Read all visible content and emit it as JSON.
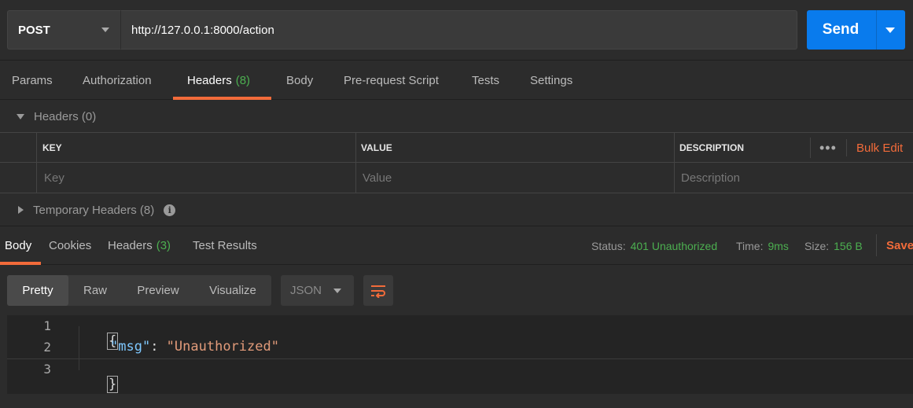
{
  "request": {
    "method": "POST",
    "url": "http://127.0.0.1:8000/action",
    "send_label": "Send"
  },
  "request_tabs": [
    {
      "label": "Params"
    },
    {
      "label": "Authorization"
    },
    {
      "label": "Headers",
      "count": "(8)"
    },
    {
      "label": "Body"
    },
    {
      "label": "Pre-request Script"
    },
    {
      "label": "Tests"
    },
    {
      "label": "Settings"
    }
  ],
  "headers_section": {
    "title": "Headers (0)",
    "columns": {
      "key": "KEY",
      "value": "VALUE",
      "description": "DESCRIPTION"
    },
    "placeholders": {
      "key": "Key",
      "value": "Value",
      "description": "Description"
    },
    "more": "•••",
    "bulk_edit": "Bulk Edit",
    "temporary_title": "Temporary Headers (8)",
    "info": "i"
  },
  "response_tabs": [
    {
      "label": "Body"
    },
    {
      "label": "Cookies"
    },
    {
      "label": "Headers",
      "count": "(3)"
    },
    {
      "label": "Test Results"
    }
  ],
  "response_status": {
    "status_label": "Status:",
    "status_value": "401 Unauthorized",
    "time_label": "Time:",
    "time_value": "9ms",
    "size_label": "Size:",
    "size_value": "156 B",
    "save_label": "Save"
  },
  "view_modes": [
    {
      "label": "Pretty"
    },
    {
      "label": "Raw"
    },
    {
      "label": "Preview"
    },
    {
      "label": "Visualize"
    }
  ],
  "format": "JSON",
  "editor": {
    "line_numbers": [
      "1",
      "2",
      "3"
    ],
    "open_brace": "{",
    "key": "\"msg\"",
    "colon": ": ",
    "value": "\"Unauthorized\"",
    "close_brace": "}"
  },
  "colors": {
    "accent": "#f26b3a",
    "send": "#097bed",
    "success": "#4caf50"
  },
  "icons": {
    "method_dropdown": "chevron-down-icon",
    "send_dropdown": "chevron-down-icon",
    "collapse": "triangle-down-icon",
    "expand": "triangle-right-icon",
    "info": "info-icon",
    "wrap": "wrap-lines-icon"
  }
}
